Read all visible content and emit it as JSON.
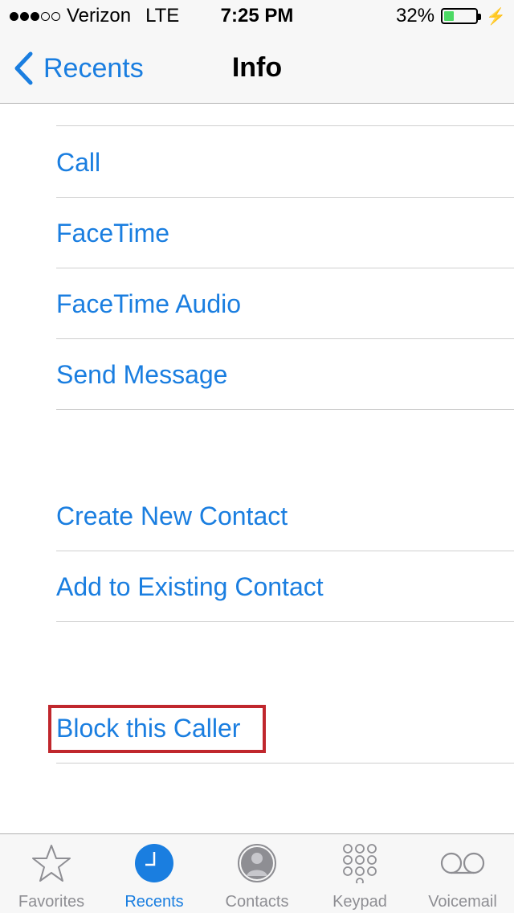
{
  "status_bar": {
    "carrier": "Verizon",
    "network": "LTE",
    "time": "7:25 PM",
    "battery_percent": "32%",
    "battery_level": 0.32,
    "signal_bars_filled": 3,
    "signal_bars_total": 5
  },
  "nav": {
    "back_label": "Recents",
    "title": "Info"
  },
  "actions": {
    "call": "Call",
    "facetime": "FaceTime",
    "facetime_audio": "FaceTime Audio",
    "send_message": "Send Message",
    "create_contact": "Create New Contact",
    "add_existing": "Add to Existing Contact",
    "block_caller": "Block this Caller"
  },
  "tab_bar": {
    "favorites": "Favorites",
    "recents": "Recents",
    "contacts": "Contacts",
    "keypad": "Keypad",
    "voicemail": "Voicemail",
    "active": "recents"
  },
  "colors": {
    "accent": "#1a7ee0",
    "highlight": "#c0272d",
    "inactive": "#8e8e93",
    "battery": "#4cd964"
  }
}
